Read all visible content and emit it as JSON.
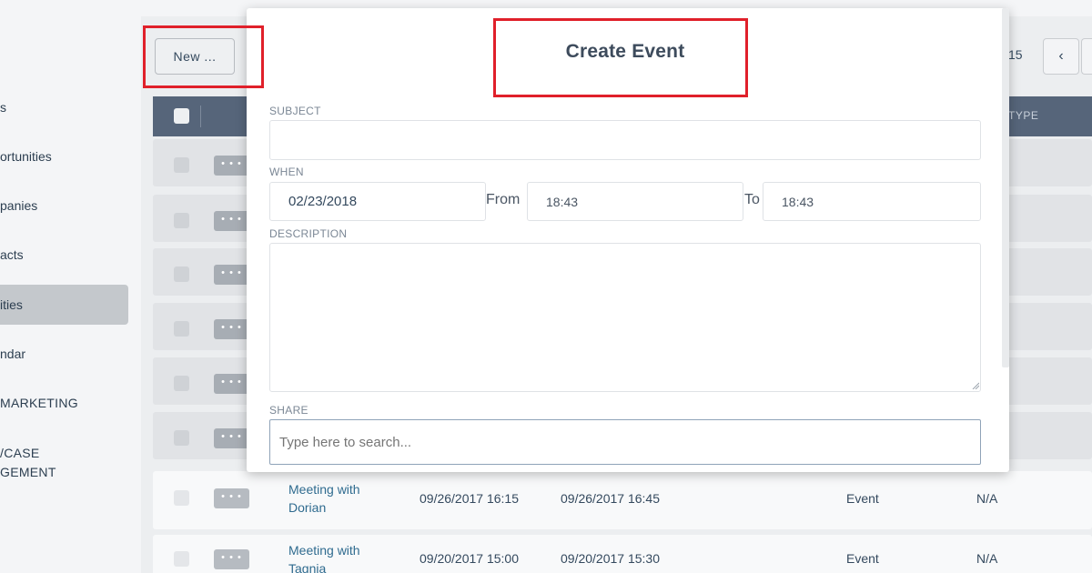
{
  "sidebar": {
    "items": [
      {
        "label": "s"
      },
      {
        "label": "ortunities"
      },
      {
        "label": "panies"
      },
      {
        "label": "acts"
      },
      {
        "label": "ities"
      },
      {
        "label": "ndar"
      },
      {
        "label": "MARKETING"
      },
      {
        "label_line1": "/CASE",
        "label_line2": "GEMENT"
      }
    ]
  },
  "toolbar": {
    "new_label": "New ...",
    "page_number": "15",
    "prev_icon": "‹"
  },
  "table": {
    "type_header": "TYPE",
    "dots_label": "• • •",
    "rows": [
      {
        "subject_line1": "Meeting with",
        "subject_line2": "Dorian",
        "start": "09/26/2017 16:15",
        "end": "09/26/2017 16:45",
        "type": "Event",
        "extra": "N/A"
      },
      {
        "subject_line1": "Meeting with",
        "subject_line2": "Tagnia",
        "start": "09/20/2017 15:00",
        "end": "09/20/2017 15:30",
        "type": "Event",
        "extra": "N/A"
      }
    ]
  },
  "modal": {
    "title": "Create Event",
    "subject_label": "SUBJECT",
    "subject_value": "",
    "when_label": "WHEN",
    "date_value": "02/23/2018",
    "from_label": "From",
    "from_value": "18:43",
    "to_label": "To",
    "to_value": "18:43",
    "description_label": "DESCRIPTION",
    "description_value": "",
    "share_label": "SHARE",
    "share_placeholder": "Type here to search..."
  },
  "colors": {
    "highlight": "#e0202a",
    "table_header": "#56657a",
    "link": "#2f6b8f"
  }
}
